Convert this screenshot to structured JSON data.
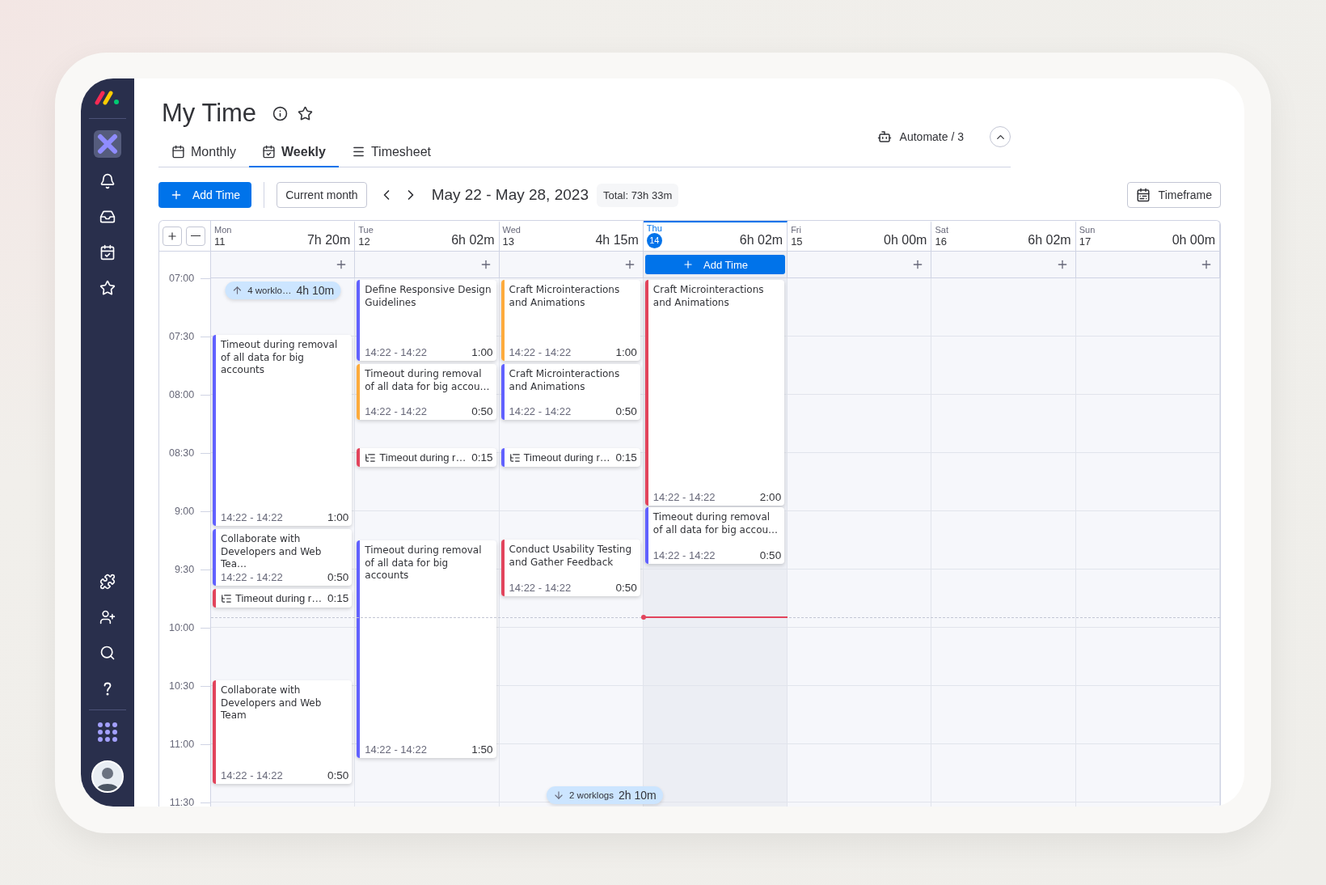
{
  "page": {
    "title": "My Time"
  },
  "tabs": [
    {
      "label": "Monthly",
      "selected": false
    },
    {
      "label": "Weekly",
      "selected": true
    },
    {
      "label": "Timesheet",
      "selected": false
    }
  ],
  "automate": {
    "label": "Automate / 3"
  },
  "toolbar": {
    "add_button": "Add Time",
    "current_button": "Current month",
    "date_range": "May 22 - May 28, 2023",
    "total": "Total: 73h 33m",
    "timeframe_button": "Timeframe"
  },
  "calendar": {
    "times": [
      "07:00",
      "07:30",
      "08:00",
      "08:30",
      "9:00",
      "9:30",
      "10:00",
      "10:30",
      "11:00",
      "11:30"
    ],
    "days": [
      {
        "name": "Mon",
        "date": "11",
        "total": "7h 20m",
        "today": false,
        "chip": {
          "label": "4 worklo…",
          "total": "4h 10m"
        },
        "events": [
          {
            "kind": "entry",
            "title": "Timeout during removal of all data for big accounts",
            "time": "14:22 - 14:22",
            "duration": "1:00",
            "color": "#6161ff"
          },
          {
            "kind": "entry",
            "title": "Collaborate with Developers and Web Tea…",
            "time": "14:22 - 14:22",
            "duration": "0:50",
            "color": "#6161ff"
          },
          {
            "kind": "subtask",
            "title": "Timeout during r…",
            "duration": "0:15",
            "color": "#e2445c"
          },
          {
            "kind": "entry",
            "title": "Collaborate with Developers and Web Team",
            "time": "14:22 - 14:22",
            "duration": "0:50",
            "color": "#e2445c"
          }
        ]
      },
      {
        "name": "Tue",
        "date": "12",
        "total": "6h 02m",
        "today": false,
        "events": [
          {
            "kind": "entry",
            "title": "Define Responsive Design Guidelines",
            "time": "14:22 - 14:22",
            "duration": "1:00",
            "color": "#6161ff"
          },
          {
            "kind": "entry",
            "title": "Timeout during removal of all data for big accou…",
            "time": "14:22 - 14:22",
            "duration": "0:50",
            "color": "#fdab3d"
          },
          {
            "kind": "subtask",
            "title": "Timeout during r…",
            "duration": "0:15",
            "color": "#e2445c"
          },
          {
            "kind": "entry",
            "title": "Timeout during removal of all data for big accounts",
            "time": "14:22 - 14:22",
            "duration": "1:50",
            "color": "#6161ff"
          }
        ]
      },
      {
        "name": "Wed",
        "date": "13",
        "total": "4h 15m",
        "today": false,
        "events": [
          {
            "kind": "entry",
            "title": "Craft Microinteractions and Animations",
            "time": "14:22 - 14:22",
            "duration": "1:00",
            "color": "#fdab3d"
          },
          {
            "kind": "entry",
            "title": "Craft Microinteractions and Animations",
            "time": "14:22 - 14:22",
            "duration": "0:50",
            "color": "#6161ff"
          },
          {
            "kind": "subtask",
            "title": "Timeout during r…",
            "duration": "0:15",
            "color": "#6161ff"
          },
          {
            "kind": "entry",
            "title": "Conduct Usability Testing and Gather Feedback",
            "time": "14:22 - 14:22",
            "duration": "0:50",
            "color": "#e2445c"
          }
        ]
      },
      {
        "name": "Thu",
        "date": "14",
        "total": "6h 02m",
        "today": true,
        "add_label": "Add Time",
        "events": [
          {
            "kind": "entry",
            "title": "Craft Microinteractions and Animations",
            "time": "14:22 - 14:22",
            "duration": "2:00",
            "color": "#e2445c"
          },
          {
            "kind": "entry",
            "title": "Timeout during removal of all data for big accou…",
            "time": "14:22 - 14:22",
            "duration": "0:50",
            "color": "#6161ff"
          }
        ]
      },
      {
        "name": "Fri",
        "date": "15",
        "total": "0h 00m",
        "today": false
      },
      {
        "name": "Sat",
        "date": "16",
        "total": "6h 02m",
        "today": false
      },
      {
        "name": "Sun",
        "date": "17",
        "total": "0h 00m",
        "today": false
      }
    ],
    "bottom_chip": {
      "label": "2 worklogs",
      "total": "2h 10m"
    }
  }
}
